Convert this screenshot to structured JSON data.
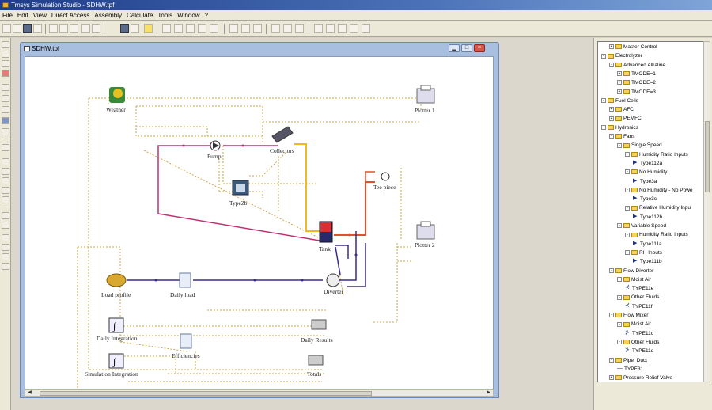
{
  "window": {
    "title": "Trnsys Simulation Studio - SDHW.tpf"
  },
  "menu": [
    "File",
    "Edit",
    "View",
    "Direct Access",
    "Assembly",
    "Calculate",
    "Tools",
    "Window",
    "?"
  ],
  "document": {
    "title": "SDHW.tpf",
    "min": "▁",
    "max": "□",
    "close": "×"
  },
  "components": {
    "weather": "Weather",
    "plotter1": "Plotter 1",
    "collectors": "Collectors",
    "pump": "Pump",
    "type2b": "Type2b",
    "tee": "Tee piece",
    "tank": "Tank",
    "plotter2": "Plotter 2",
    "load_profile": "Load profile",
    "daily_load": "Daily load",
    "diverter": "Diverter",
    "daily_integration": "Daily Integration",
    "daily_results": "Daily Results",
    "efficiencies": "Efficiencies",
    "simulation_integration": "Simulation Integration",
    "totals": "Totals"
  },
  "colors": {
    "hot": "#e0502a",
    "cold": "#3a2a8a",
    "solar": "#c03070",
    "yellow": "#f2b820",
    "control": "#c9a94a"
  },
  "tree": [
    {
      "level": 1,
      "type": "folder",
      "expander": "+",
      "label": "Master Control"
    },
    {
      "level": 0,
      "type": "folder",
      "expander": "-",
      "label": "Electrolyzer"
    },
    {
      "level": 1,
      "type": "folder",
      "expander": "-",
      "label": "Advanced Alkaline"
    },
    {
      "level": 2,
      "type": "folder",
      "expander": "+",
      "label": "TMODE=1"
    },
    {
      "level": 2,
      "type": "folder",
      "expander": "+",
      "label": "TMODE=2"
    },
    {
      "level": 2,
      "type": "folder",
      "expander": "+",
      "label": "TMODE=3"
    },
    {
      "level": 0,
      "type": "folder",
      "expander": "-",
      "label": "Fuel Cells"
    },
    {
      "level": 1,
      "type": "folder",
      "expander": "+",
      "label": "AFC"
    },
    {
      "level": 1,
      "type": "folder",
      "expander": "+",
      "label": "PEMFC"
    },
    {
      "level": 0,
      "type": "folder",
      "expander": "-",
      "label": "Hydronics"
    },
    {
      "level": 1,
      "type": "folder",
      "expander": "-",
      "label": "Fans"
    },
    {
      "level": 2,
      "type": "folder",
      "expander": "-",
      "label": "Single Speed"
    },
    {
      "level": 3,
      "type": "folder",
      "expander": "-",
      "label": "Humidity Ratio Inputs"
    },
    {
      "level": 4,
      "type": "comp",
      "icon": "▶",
      "label": "Type112a"
    },
    {
      "level": 3,
      "type": "folder",
      "expander": "-",
      "label": "No Humidity"
    },
    {
      "level": 4,
      "type": "comp",
      "icon": "▶",
      "label": "Type3a"
    },
    {
      "level": 3,
      "type": "folder",
      "expander": "-",
      "label": "No Humidity - No Powe"
    },
    {
      "level": 4,
      "type": "comp",
      "icon": "▶",
      "label": "Type3c"
    },
    {
      "level": 3,
      "type": "folder",
      "expander": "-",
      "label": "Relative Humidity Inpu"
    },
    {
      "level": 4,
      "type": "comp",
      "icon": "▶",
      "label": "Type112b"
    },
    {
      "level": 2,
      "type": "folder",
      "expander": "-",
      "label": "Variable Speed"
    },
    {
      "level": 3,
      "type": "folder",
      "expander": "-",
      "label": "Humidity Ratio Inputs"
    },
    {
      "level": 4,
      "type": "comp",
      "icon": "▶",
      "label": "Type111a"
    },
    {
      "level": 3,
      "type": "folder",
      "expander": "-",
      "label": "RH Inputs"
    },
    {
      "level": 4,
      "type": "comp",
      "icon": "▶",
      "label": "Type111b"
    },
    {
      "level": 1,
      "type": "folder",
      "expander": "-",
      "label": "Flow Diverter"
    },
    {
      "level": 2,
      "type": "folder",
      "expander": "-",
      "label": "Moist Air"
    },
    {
      "level": 3,
      "type": "comp",
      "icon": "⊀",
      "label": "TYPE11e"
    },
    {
      "level": 2,
      "type": "folder",
      "expander": "-",
      "label": "Other Fluids"
    },
    {
      "level": 3,
      "type": "comp",
      "icon": "⊀",
      "label": "TYPE11f"
    },
    {
      "level": 1,
      "type": "folder",
      "expander": "-",
      "label": "Flow Mixer"
    },
    {
      "level": 2,
      "type": "folder",
      "expander": "-",
      "label": "Moist Air"
    },
    {
      "level": 3,
      "type": "comp",
      "icon": "⊁",
      "label": "TYPE11c"
    },
    {
      "level": 2,
      "type": "folder",
      "expander": "-",
      "label": "Other Fluids"
    },
    {
      "level": 3,
      "type": "comp",
      "icon": "⊁",
      "label": "TYPE11d"
    },
    {
      "level": 1,
      "type": "folder",
      "expander": "-",
      "label": "Pipe_Duct"
    },
    {
      "level": 2,
      "type": "comp",
      "icon": "—",
      "label": "TYPE31"
    },
    {
      "level": 1,
      "type": "folder",
      "expander": "+",
      "label": "Pressure Relief Valve"
    }
  ]
}
